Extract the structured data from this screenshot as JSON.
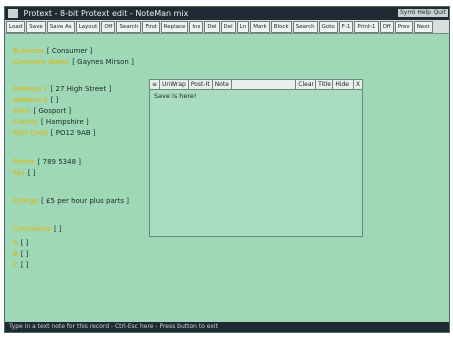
{
  "window": {
    "title": "Protext - 8-bit Protext edit - NoteMan mix",
    "buttons": [
      "Symb",
      "Help",
      "Quit"
    ]
  },
  "toolbar": {
    "buttons": [
      "Load",
      "Save",
      "Save As",
      "Layout",
      "Off",
      "Search",
      "Find",
      "Replace",
      "Ins",
      "Del",
      "Del",
      "Ln",
      "Mark",
      "Block",
      "Search",
      "Goto",
      "F-1",
      "Print-1",
      "Off",
      "Prev",
      "Next"
    ]
  },
  "form": {
    "fields": [
      {
        "label": "Business",
        "value": "[ Consumer ]"
      },
      {
        "label": "Company Name",
        "value": "[ Gaynes Mirson ]"
      },
      {
        "label": "Address 1",
        "value": "[ 27 High Street ]"
      },
      {
        "label": "Address 2",
        "value": "[ ]"
      },
      {
        "label": "Town",
        "value": "[ Gosport ]"
      },
      {
        "label": "County",
        "value": "[ Hampshire ]"
      },
      {
        "label": "Post Code",
        "value": "[ PO12 9AB ]"
      },
      {
        "label": "Phone",
        "value": "[ 789 5348 ]"
      },
      {
        "label": "Fax",
        "value": "[ ]"
      },
      {
        "label": "Charge",
        "value": "[ £5 per hour plus parts ]"
      },
      {
        "label": "Comments",
        "value": "[ ]"
      },
      {
        "label": "A",
        "value": "[ ]"
      },
      {
        "label": "B",
        "value": "[ ]"
      },
      {
        "label": "C",
        "value": "[ ]"
      }
    ]
  },
  "note": {
    "title_buttons": [
      "≡",
      "UnWrap",
      "Post-It",
      "Note"
    ],
    "right_buttons": [
      "Clear",
      "Title",
      "Hide",
      "X"
    ],
    "text": "Save is here!"
  },
  "status": {
    "text": "Type in a text note for this record - Ctrl-Esc here - Press button to exit"
  }
}
